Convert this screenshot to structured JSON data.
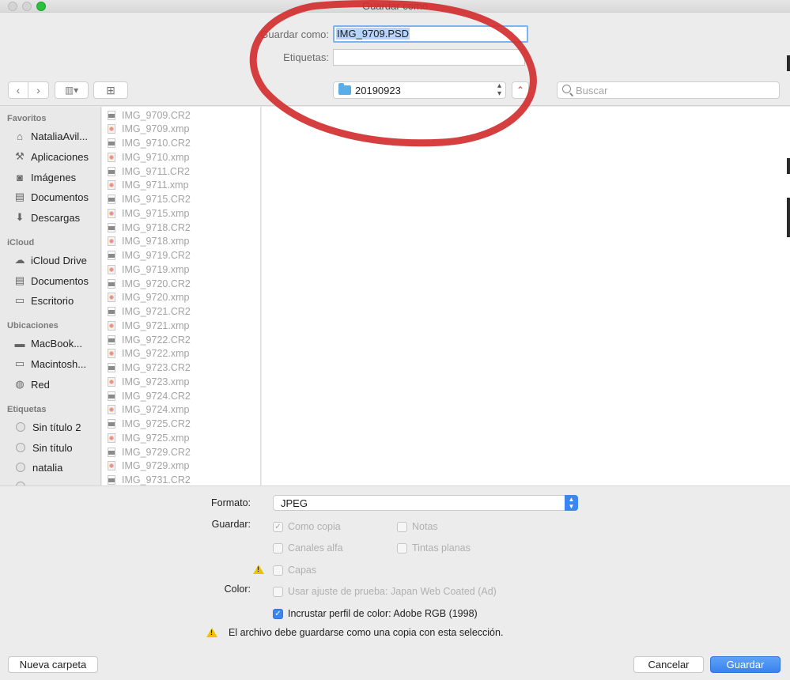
{
  "window": {
    "title": "Guardar como"
  },
  "top": {
    "save_as_label": "Guardar como:",
    "file_name": "IMG_9709.PSD",
    "tags_label": "Etiquetas:",
    "tags_value": ""
  },
  "toolbar": {
    "back_icon": "‹",
    "forward_icon": "›",
    "view_icon": "▥▾",
    "new_folder_icon": "⊞",
    "location": "20190923",
    "up_icon": "⌃",
    "search_placeholder": "Buscar"
  },
  "sidebar": {
    "favorites_title": "Favoritos",
    "favorites": [
      {
        "label": "NataliaAvil...",
        "icon": "home-icon",
        "glyph": "⌂"
      },
      {
        "label": "Aplicaciones",
        "icon": "applications-icon",
        "glyph": "⚒"
      },
      {
        "label": "Imágenes",
        "icon": "camera-icon",
        "glyph": "◙"
      },
      {
        "label": "Documentos",
        "icon": "document-icon",
        "glyph": "▤"
      },
      {
        "label": "Descargas",
        "icon": "download-icon",
        "glyph": "⬇"
      }
    ],
    "icloud_title": "iCloud",
    "icloud": [
      {
        "label": "iCloud Drive",
        "icon": "cloud-icon",
        "glyph": "☁"
      },
      {
        "label": "Documentos",
        "icon": "document-icon",
        "glyph": "▤"
      },
      {
        "label": "Escritorio",
        "icon": "desktop-icon",
        "glyph": "▭"
      }
    ],
    "locations_title": "Ubicaciones",
    "locations": [
      {
        "label": "MacBook...",
        "icon": "laptop-icon",
        "glyph": "▬"
      },
      {
        "label": "Macintosh...",
        "icon": "disk-icon",
        "glyph": "▭"
      },
      {
        "label": "Red",
        "icon": "network-icon",
        "glyph": "◍"
      }
    ],
    "tags_title": "Etiquetas",
    "tags": [
      {
        "label": "Sin título 2"
      },
      {
        "label": "Sin título"
      },
      {
        "label": "natalia"
      }
    ]
  },
  "files": [
    "IMG_9709.CR2",
    "IMG_9709.xmp",
    "IMG_9710.CR2",
    "IMG_9710.xmp",
    "IMG_9711.CR2",
    "IMG_9711.xmp",
    "IMG_9715.CR2",
    "IMG_9715.xmp",
    "IMG_9718.CR2",
    "IMG_9718.xmp",
    "IMG_9719.CR2",
    "IMG_9719.xmp",
    "IMG_9720.CR2",
    "IMG_9720.xmp",
    "IMG_9721.CR2",
    "IMG_9721.xmp",
    "IMG_9722.CR2",
    "IMG_9722.xmp",
    "IMG_9723.CR2",
    "IMG_9723.xmp",
    "IMG_9724.CR2",
    "IMG_9724.xmp",
    "IMG_9725.CR2",
    "IMG_9725.xmp",
    "IMG_9729.CR2",
    "IMG_9729.xmp",
    "IMG_9731.CR2"
  ],
  "options": {
    "format_label": "Formato:",
    "format_value": "JPEG",
    "save_label": "Guardar:",
    "as_copy": "Como copia",
    "notes": "Notas",
    "alpha_channels": "Canales alfa",
    "spot_colors": "Tintas planas",
    "layers": "Capas",
    "color_label": "Color:",
    "proof_setup": "Usar ajuste de prueba: Japan Web Coated (Ad)",
    "embed_profile": "Incrustar perfil de color: Adobe RGB (1998)",
    "warning_message": "El archivo debe guardarse como una copia con esta selección."
  },
  "buttons": {
    "new_folder": "Nueva carpeta",
    "cancel": "Cancelar",
    "save": "Guardar"
  },
  "colors": {
    "accent": "#3b86f0",
    "annotation": "#d32f2f",
    "warning": "#f2c200"
  }
}
